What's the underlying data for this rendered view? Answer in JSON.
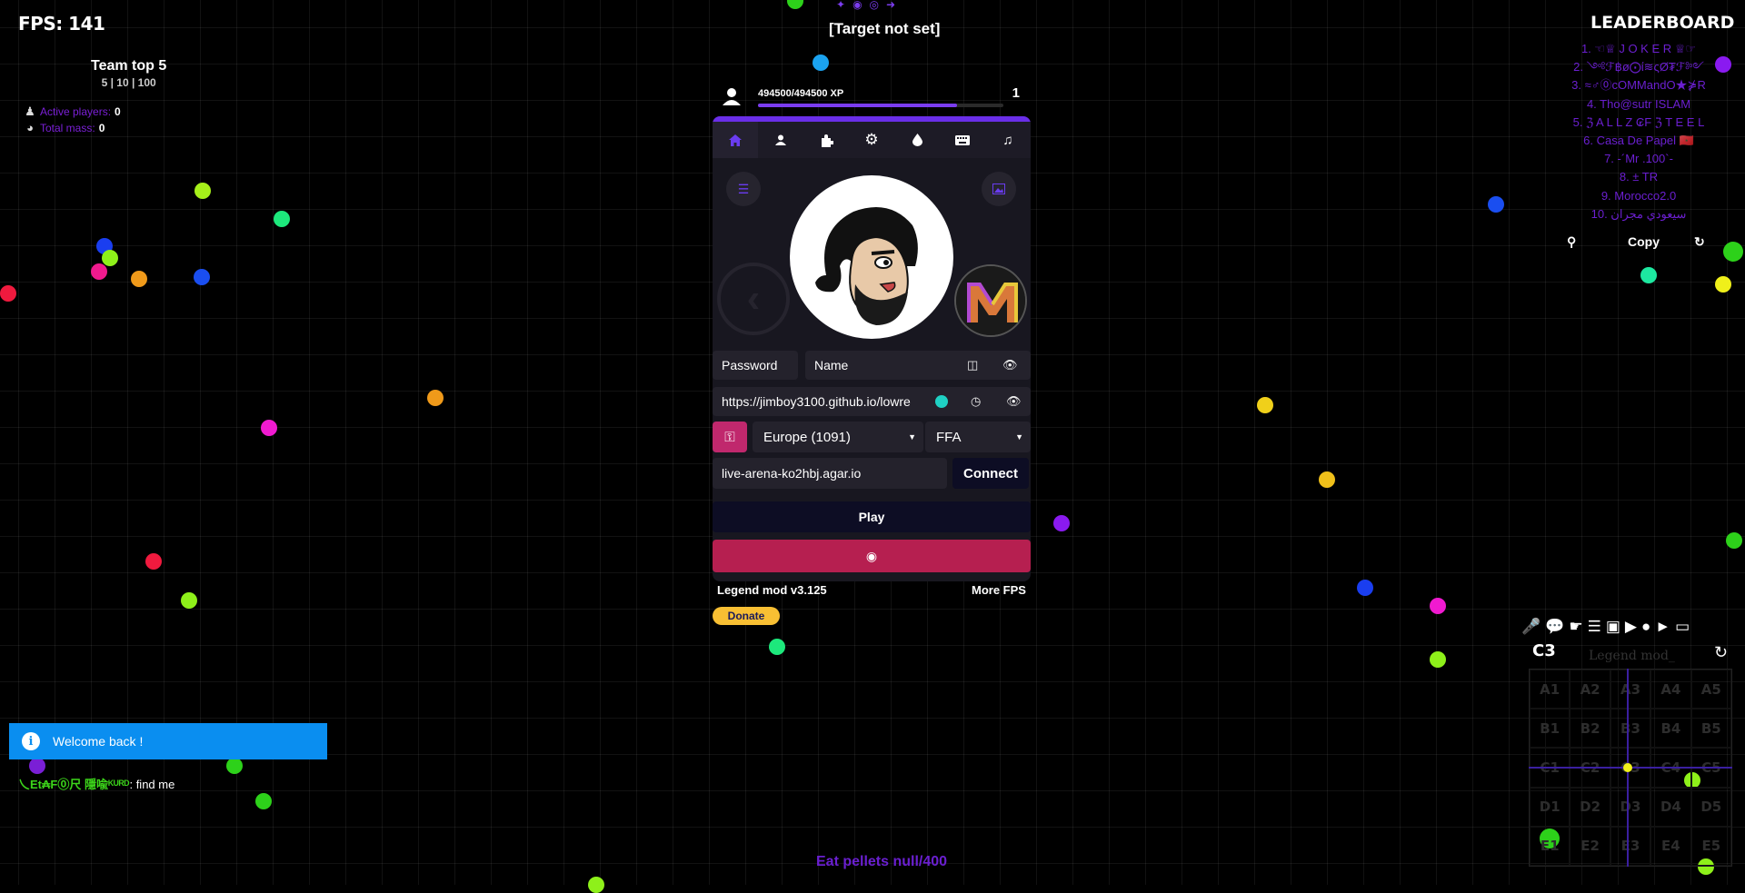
{
  "hud": {
    "fps": "FPS: 141",
    "team_title": "Team top 5",
    "team_sub": "5 | 10 | 100",
    "active_players_label": "Active players:",
    "active_players_value": "0",
    "total_mass_label": "Total mass:",
    "total_mass_value": "0",
    "target": "[Target not set]"
  },
  "xp": {
    "text": "494500/494500 XP",
    "level": "1",
    "progress": 0.81
  },
  "panel": {
    "tabs": [
      "home-icon",
      "user-icon",
      "puzzle-icon",
      "gear-icon",
      "drop-icon",
      "keyboard-icon",
      "music-icon"
    ],
    "password_placeholder": "Password",
    "name_placeholder": "Name",
    "skin_url": "https://jimboy3100.github.io/lowre",
    "region": "Europe (1091)",
    "mode": "FFA",
    "server": "live-arena-ko2hbj.agar.io",
    "connect_label": "Connect",
    "play_label": "Play",
    "version": "Legend mod v3.125",
    "more_fps": "More FPS",
    "donate": "Donate"
  },
  "leaderboard": {
    "title": "LEADERBOARD",
    "entries": [
      "1. ☜♕ J O K E R ♕☞",
      "2. ༺ℱ฿ø⨀ί≋ςØ₮ℱ༻",
      "3. ≈♂⓪cOMMandO★⋡R",
      "4. Tho@sutr ISLAM",
      "5. ℨ A L L Z ₢F ℨ T E E L",
      "6. Casa De Papel 🇲🇦",
      "7. -´Mr .100`-",
      "8. ± TR",
      "9. Morocco2.0",
      "10. سيعودي مجران"
    ],
    "copy_label": "Copy"
  },
  "chat": {
    "toast": "Welcome back !",
    "nick": "乀Et₳F⓪尺 隱喩ᴷᵁᴿᴰ",
    "message": ": find me"
  },
  "footer": {
    "pellets": "Eat pellets null/400"
  },
  "minimap": {
    "title": "C3",
    "mod_label": "Legend mod_",
    "cells": [
      "A1",
      "A2",
      "A3",
      "A4",
      "A5",
      "B1",
      "B2",
      "B3",
      "B4",
      "B5",
      "C1",
      "C2",
      "C3",
      "C4",
      "C5",
      "D1",
      "D2",
      "D3",
      "D4",
      "D5",
      "E1",
      "E2",
      "E3",
      "E4",
      "E5"
    ]
  },
  "colors": {
    "accent": "#6a2ee8",
    "play_dark": "#0d0d24",
    "key_pink": "#c0286d",
    "red_button": "#b61f50",
    "toast_blue": "#0a8ef0",
    "leaderboard_purple": "#6b1fd0"
  }
}
